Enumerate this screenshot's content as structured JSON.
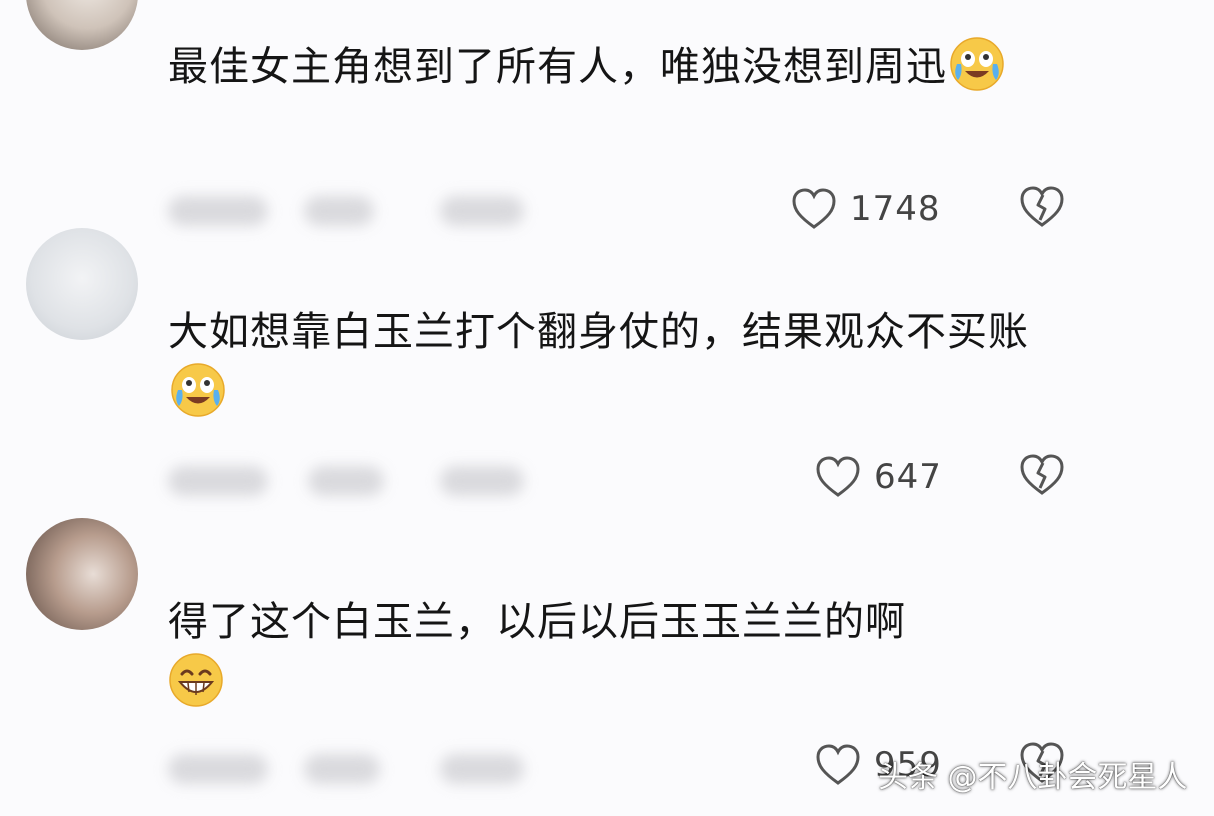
{
  "comments": [
    {
      "text": "最佳女主角想到了所有人，唯独没想到周迅",
      "emoji": "laugh-cry-emoji",
      "like_count": "1748"
    },
    {
      "text": "大如想靠白玉兰打个翻身仗的，结果观众不买账",
      "emoji": "laugh-cry-emoji",
      "like_count": "647"
    },
    {
      "text": "得了这个白玉兰，以后以后玉玉兰兰的啊",
      "emoji": "grin-emoji",
      "like_count": "959"
    }
  ],
  "icons": {
    "like": "heart-outline-icon",
    "dislike": "broken-heart-icon"
  },
  "watermark": "头条 @不八卦会死星人",
  "colors": {
    "background": "#fbfbfd",
    "text": "#151515",
    "icon": "#555555",
    "emoji_face": "#f7c948"
  }
}
